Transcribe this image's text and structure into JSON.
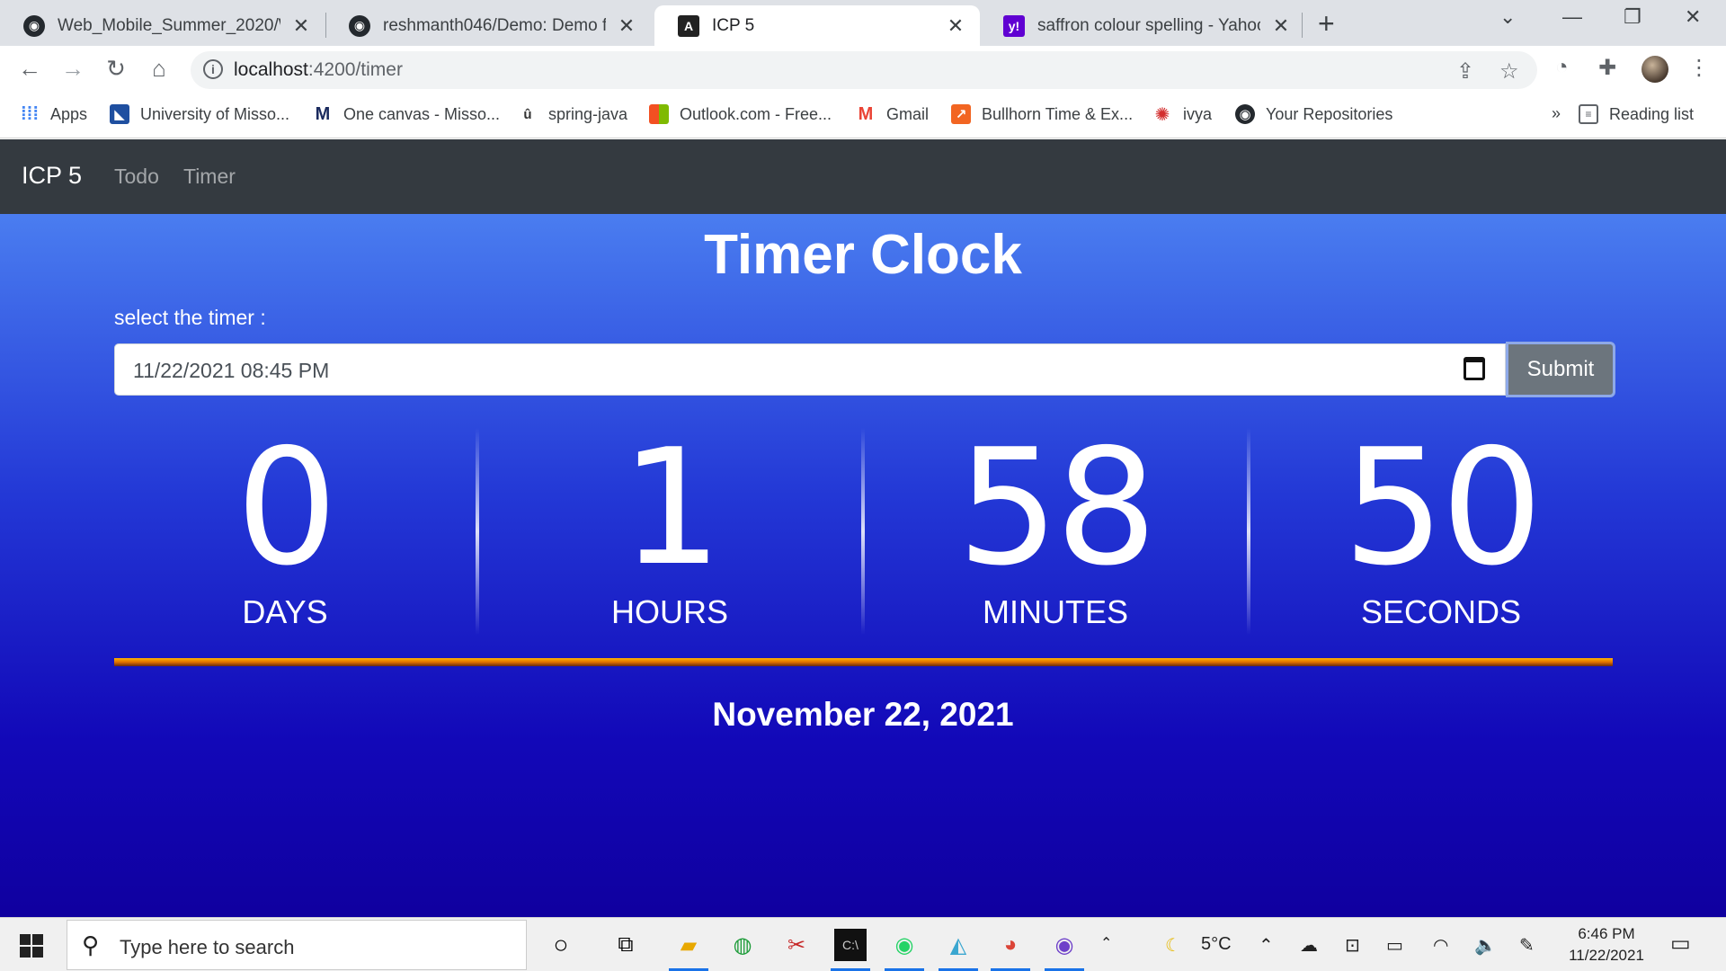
{
  "browser": {
    "tabs": [
      {
        "title": "Web_Mobile_Summer_2020/Web",
        "icon": "github-icon"
      },
      {
        "title": "reshmanth046/Demo: Demo for",
        "icon": "github-icon"
      },
      {
        "title": "ICP 5",
        "icon": "angular-icon",
        "active": true
      },
      {
        "title": "saffron colour spelling - Yahoo Se",
        "icon": "yahoo-icon"
      }
    ],
    "url_host": "localhost",
    "url_path": ":4200/timer",
    "bookmarks": [
      {
        "label": "Apps",
        "icon": "apps-grid-icon"
      },
      {
        "label": "University of Misso...",
        "icon": "university-icon"
      },
      {
        "label": "One canvas - Misso...",
        "icon": "canvas-m-icon"
      },
      {
        "label": "spring-java",
        "icon": "spring-icon"
      },
      {
        "label": "Outlook.com - Free...",
        "icon": "microsoft-icon"
      },
      {
        "label": "Gmail",
        "icon": "gmail-icon"
      },
      {
        "label": "Bullhorn Time & Ex...",
        "icon": "bullhorn-icon"
      },
      {
        "label": "ivya",
        "icon": "ivya-icon"
      },
      {
        "label": "Your Repositories",
        "icon": "github-icon"
      }
    ],
    "overflow_label": "»",
    "reading_list": "Reading list"
  },
  "app": {
    "brand": "ICP 5",
    "nav": [
      "Todo",
      "Timer"
    ],
    "title": "Timer Clock",
    "select_label": "select the timer :",
    "datetime_value": "11/22/2021  08:45  PM",
    "submit_label": "Submit",
    "countdown": [
      {
        "value": "0",
        "label": "DAYS"
      },
      {
        "value": "1",
        "label": "HOURS"
      },
      {
        "value": "58",
        "label": "MINUTES"
      },
      {
        "value": "50",
        "label": "SECONDS"
      }
    ],
    "date": "November 22, 2021",
    "colors": {
      "navbar": "#343a40",
      "gradient_top": "#4a7df0",
      "gradient_bottom": "#10009f",
      "saffron": "#e07000"
    }
  },
  "taskbar": {
    "search_placeholder": "Type here to search",
    "weather": "5°C",
    "time": "6:46 PM",
    "date": "11/22/2021"
  }
}
